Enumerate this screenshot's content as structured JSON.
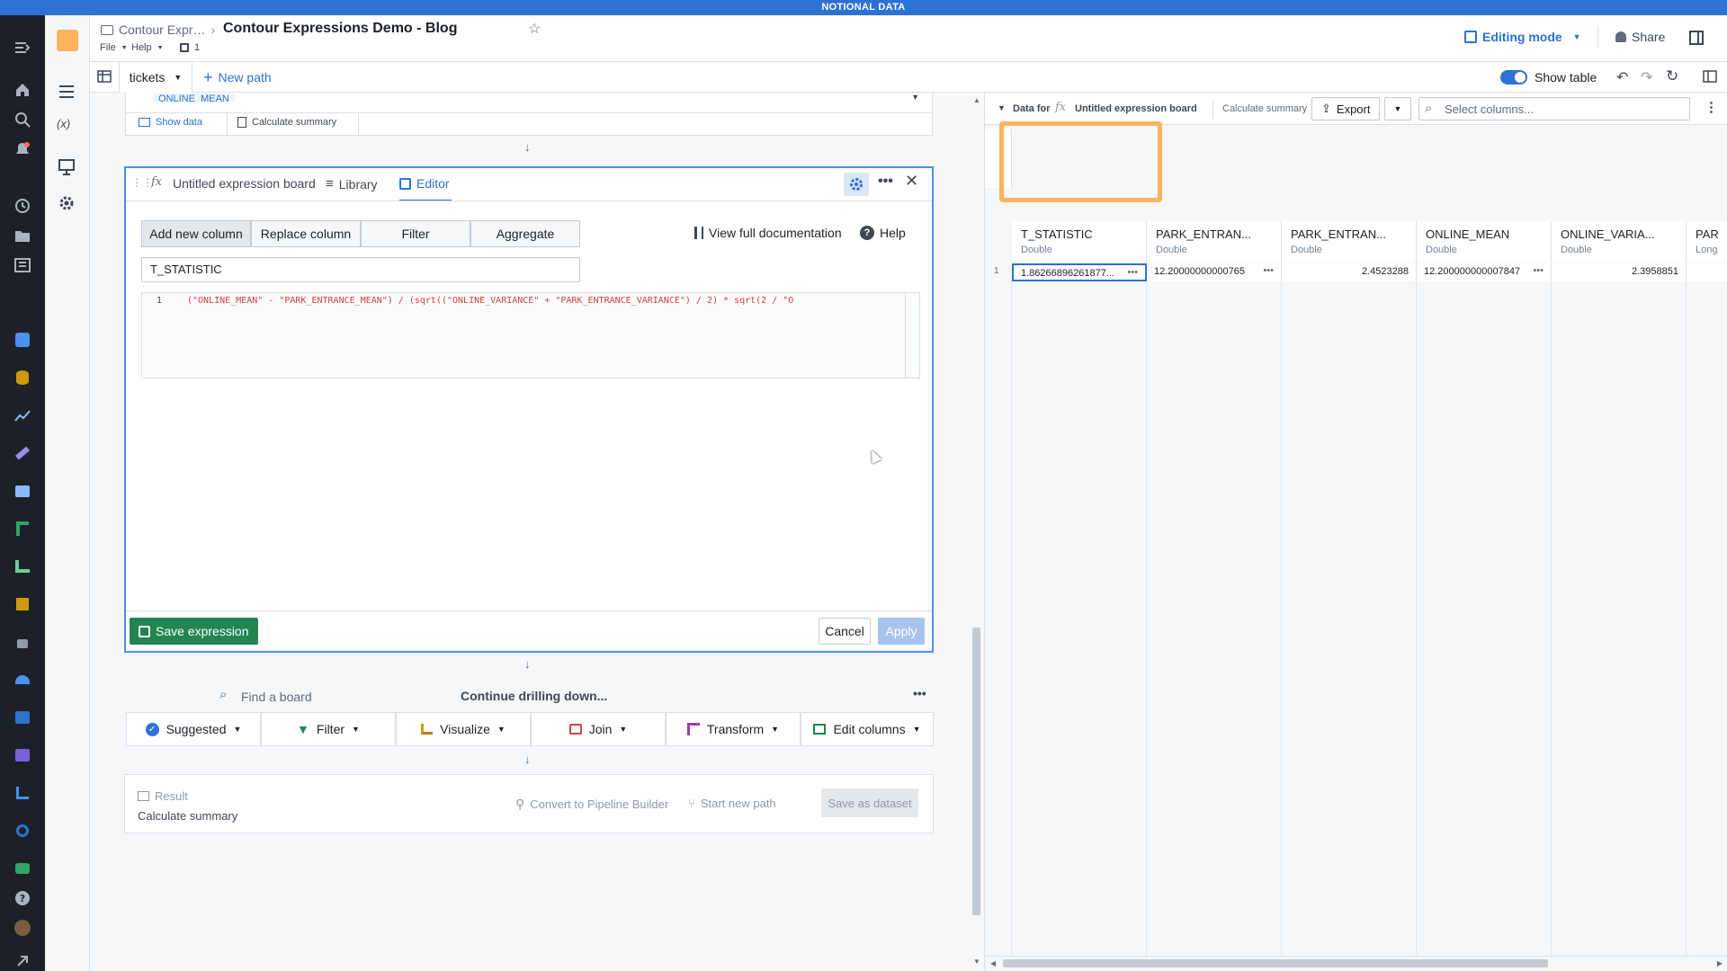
{
  "banner": "NOTIONAL DATA",
  "header": {
    "breadcrumb_parent": "Contour Expr…",
    "title": "Contour Expressions Demo - Blog",
    "menu_file": "File",
    "menu_help": "Help",
    "branch_count": "1",
    "editing_mode": "Editing mode",
    "share": "Share"
  },
  "pathbar": {
    "dataset_tab": "tickets",
    "new_path": "New path",
    "show_table": "Show table"
  },
  "prev_board": {
    "truncated_text": "ONLINE_MEAN",
    "show_data": "Show data",
    "calculate_summary": "Calculate summary"
  },
  "expression_board": {
    "title": "Untitled expression board",
    "tab_library": "Library",
    "tab_editor": "Editor",
    "modes": [
      "Add new column",
      "Replace column",
      "Filter",
      "Aggregate"
    ],
    "view_docs": "View full documentation",
    "help": "Help",
    "column_name": "T_STATISTIC",
    "line_number": "1",
    "code": "(\"ONLINE_MEAN\" - \"PARK_ENTRANCE_MEAN\") / (sqrt((\"ONLINE_VARIANCE\" + \"PARK_ENTRANCE_VARIANCE\") / 2) * sqrt(2 / \"O",
    "save_expression": "Save expression",
    "cancel": "Cancel",
    "apply": "Apply"
  },
  "next_board": {
    "find_placeholder": "Find a board",
    "continue_label": "Continue drilling down...",
    "tools": [
      "Suggested",
      "Filter",
      "Visualize",
      "Join",
      "Transform",
      "Edit columns"
    ]
  },
  "result": {
    "label": "Result",
    "subtitle": "Calculate summary",
    "convert": "Convert to Pipeline Builder",
    "start_new_path": "Start new path",
    "save_dataset": "Save as dataset"
  },
  "table_panel": {
    "data_for": "Data for",
    "board_name": "Untitled expression board",
    "calculate_summary": "Calculate summary",
    "export": "Export",
    "select_columns_placeholder": "Select columns...",
    "columns": [
      {
        "name": "T_STATISTIC",
        "type": "Double",
        "value": "1.86266896261877..."
      },
      {
        "name": "PARK_ENTRAN...",
        "type": "Double",
        "value": "12.20000000000765"
      },
      {
        "name": "PARK_ENTRAN...",
        "type": "Double",
        "value": "2.4523288"
      },
      {
        "name": "ONLINE_MEAN",
        "type": "Double",
        "value": "12.200000000007847"
      },
      {
        "name": "ONLINE_VARIA...",
        "type": "Double",
        "value": "2.3958851"
      },
      {
        "name": "PARK_",
        "type": "Long",
        "value": ""
      }
    ],
    "row_number": "1"
  },
  "colors": {
    "banner": "#2d72d2",
    "nav": "#1c2127",
    "accent": "#2d72d2",
    "save_green": "#238551",
    "highlight": "#fbb360"
  }
}
